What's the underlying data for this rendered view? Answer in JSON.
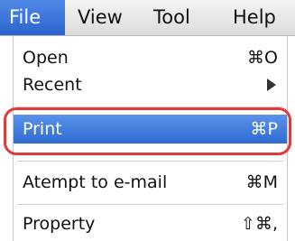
{
  "menubar": {
    "items": [
      {
        "label": "File",
        "active": true
      },
      {
        "label": "View",
        "active": false
      },
      {
        "label": "Tool",
        "active": false
      },
      {
        "label": "Help",
        "active": false
      }
    ]
  },
  "file_menu": {
    "items": [
      {
        "label": "Open",
        "shortcut": "⌘O"
      },
      {
        "label": "Recent",
        "submenu_icon": "submenu-arrow-icon"
      },
      {
        "label": "Print",
        "shortcut": "⌘P",
        "highlighted": true
      },
      {
        "label": "Atempt to e-mail",
        "shortcut": "⌘M"
      },
      {
        "label": "Property",
        "shortcut": "⇧⌘,"
      }
    ]
  },
  "colors": {
    "highlight": "#2f6ad3",
    "callout": "#e03a3a"
  }
}
